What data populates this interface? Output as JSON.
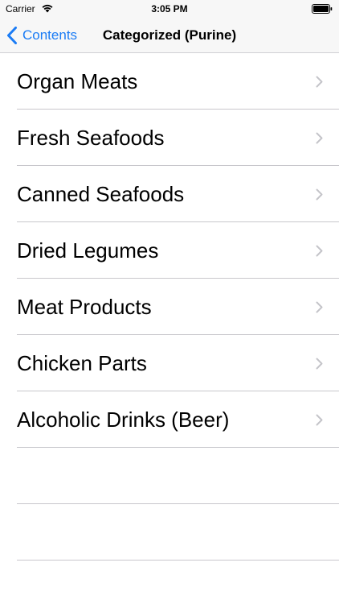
{
  "status_bar": {
    "carrier": "Carrier",
    "time": "3:05 PM",
    "wifi_icon": "wifi-icon",
    "battery_icon": "battery-icon"
  },
  "nav": {
    "back_label": "Contents",
    "title": "Categorized (Purine)",
    "accent_color": "#1b7cf5"
  },
  "categories": [
    {
      "label": "Organ Meats"
    },
    {
      "label": "Fresh Seafoods"
    },
    {
      "label": "Canned Seafoods"
    },
    {
      "label": "Dried Legumes"
    },
    {
      "label": "Meat Products"
    },
    {
      "label": "Chicken Parts"
    },
    {
      "label": "Alcoholic Drinks (Beer)"
    }
  ]
}
